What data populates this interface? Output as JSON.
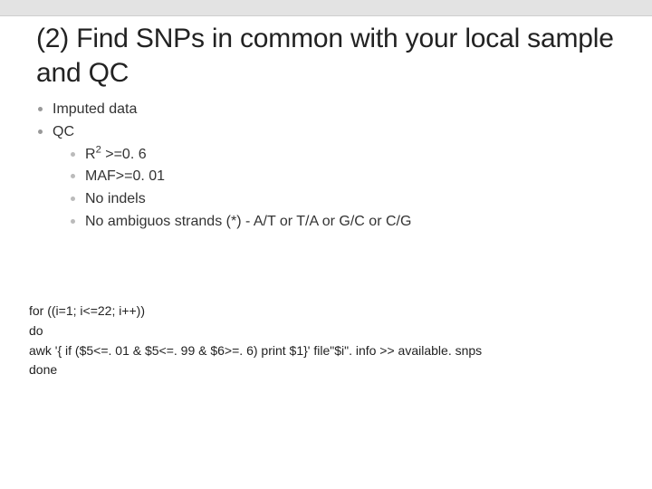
{
  "title": "(2) Find SNPs in common with your local sample and QC",
  "bullets": {
    "l1": [
      "Imputed data",
      "QC"
    ],
    "l2_prefix": "R",
    "l2_super": "2",
    "l2_suffix": " >=0. 6",
    "l2": [
      "MAF>=0. 01",
      "No indels",
      "No ambiguos strands (*)  - A/T  or T/A or G/C or C/G"
    ]
  },
  "code": {
    "lines": [
      "for ((i=1; i<=22; i++))",
      "do",
      "awk '{ if ($5<=. 01 & $5<=. 99 & $6>=. 6) print $1}' file\"$i\". info >> available. snps",
      "done"
    ]
  }
}
